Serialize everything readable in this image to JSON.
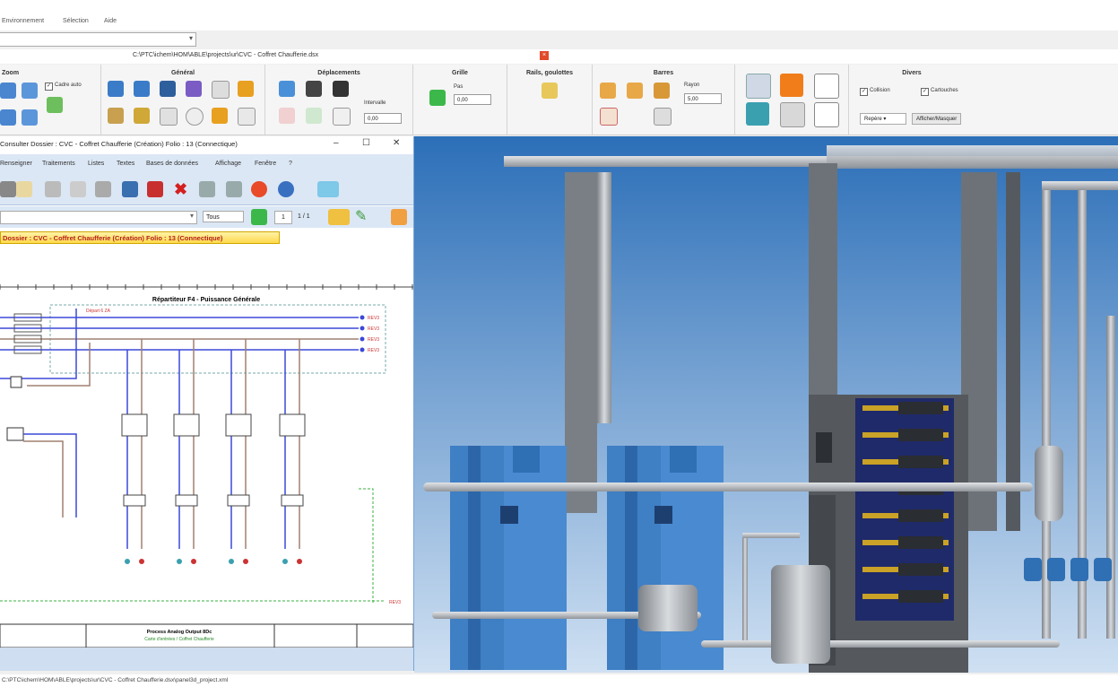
{
  "menu": [
    "Environnement",
    "Sélection",
    "Aide"
  ],
  "titlebar": {
    "path": "C:\\PTC\\ichem\\HOM\\ABLE\\projects\\ur\\CVC - Coffret Chaufferie.dsx",
    "close": "×"
  },
  "ribbon": {
    "groups": {
      "zoom": "Zoom",
      "general": "Général",
      "deplacements": "Déplacements",
      "grille": "Grille",
      "rails": "Rails, goulottes",
      "barres": "Barres",
      "divers": "Divers"
    },
    "cadre_auto": "Cadre auto",
    "intervalle_label": "Intervalle",
    "intervalle_value": "0,00",
    "pas_label": "Pas",
    "pas_value": "0,00",
    "rayon_label": "Rayon",
    "rayon_value": "5,00",
    "collision": "Collision",
    "cartouches": "Cartouches",
    "repere": "Repère",
    "afficher_masquer": "Afficher/Masquer"
  },
  "child": {
    "title": "Consulter Dossier : CVC - Coffret Chaufferie (Création) Folio : 13 (Connectique)",
    "controls": [
      "–",
      "☐",
      "✕"
    ],
    "menu": [
      "Renseigner",
      "Traitements",
      "Listes",
      "Textes",
      "Bases de données",
      "Affichage",
      "Fenêtre",
      "?"
    ],
    "filter": "Tous",
    "page": "1",
    "pages": "1 / 1",
    "tab": "Dossier : CVC - Coffret Chaufferie (Création) Folio : 13 (Connectique)",
    "sheet_title": "Répartiteur F4 - Puissance Générale",
    "top_tag": "Départ 6 ZA",
    "bus_labels": [
      "REV3",
      "REV3",
      "REV3",
      "REV3"
    ],
    "out_label": "REV3",
    "footer_title": "Process Analog Output 8Dc",
    "footer_sub": "Carte d'entrées / Coffret Chaufferie"
  },
  "status": "C:\\PTC\\ichem\\HOM\\ABLE\\projects\\ur\\CVC - Coffret Chaufferie.dsx\\panel3d_project.xml",
  "colors": {
    "sky_top": "#2c6fb8",
    "sky_bottom": "#cfe0f2",
    "boiler": "#3f7fc4",
    "accent": "#e8a020"
  }
}
